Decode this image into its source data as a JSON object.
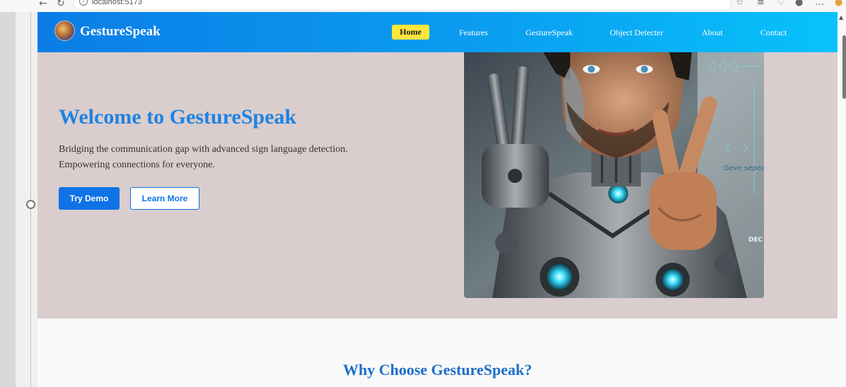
{
  "browser": {
    "url": "localhost:5173",
    "back_icon": "arrow-left-icon",
    "reload_icon": "reload-icon"
  },
  "brand": {
    "name": "GestureSpeak",
    "colors": {
      "navbar_start": "#0a7de6",
      "navbar_end": "#08c2fb",
      "active_nav": "#ffe63b",
      "accent": "#1d82e3",
      "hero_bg": "#dacdcd"
    }
  },
  "nav": {
    "items": [
      {
        "label": "Home",
        "active": true
      },
      {
        "label": "Features"
      },
      {
        "label": "GestureSpeak"
      },
      {
        "label": "Object Detecter"
      },
      {
        "label": "About"
      },
      {
        "label": "Contact"
      }
    ]
  },
  "hero": {
    "title": "Welcome to GestureSpeak",
    "line1": "Bridging the communication gap with advanced sign language detection.",
    "line2": "Empowering connections for everyone.",
    "primary_button": "Try Demo",
    "secondary_button": "Learn More",
    "image_text": "Geve sepeak",
    "image_badge": "DEC"
  },
  "section": {
    "title": "Why Choose GestureSpeak?"
  }
}
